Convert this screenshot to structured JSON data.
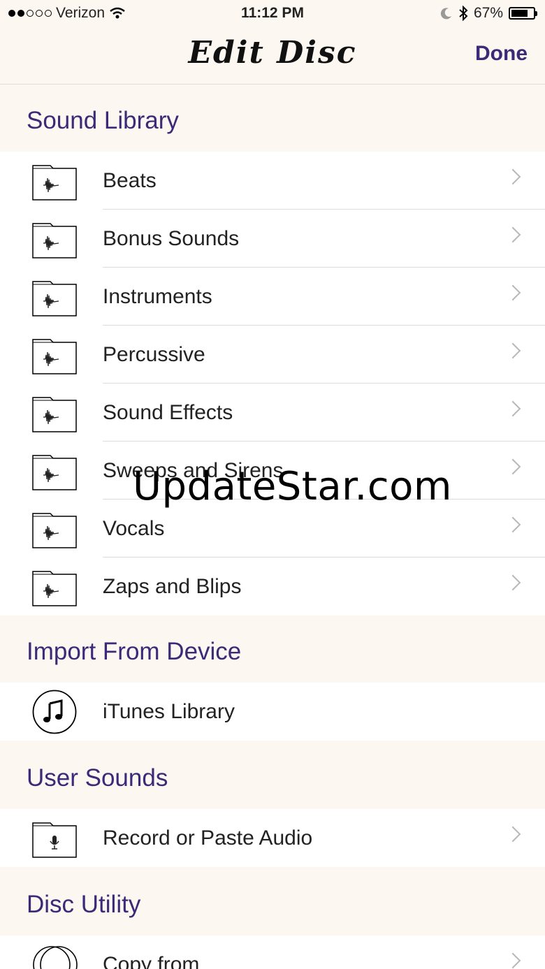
{
  "status_bar": {
    "carrier": "Verizon",
    "time": "11:12 PM",
    "battery": "67%"
  },
  "nav": {
    "title": "Edit Disc",
    "done": "Done"
  },
  "sections": {
    "sound_library": {
      "header": "Sound Library",
      "items": [
        "Beats",
        "Bonus Sounds",
        "Instruments",
        "Percussive",
        "Sound Effects",
        "Sweeps and Sirens",
        "Vocals",
        "Zaps and Blips"
      ]
    },
    "import_from_device": {
      "header": "Import From Device",
      "items": [
        "iTunes Library"
      ]
    },
    "user_sounds": {
      "header": "User Sounds",
      "items": [
        "Record or Paste Audio"
      ]
    },
    "disc_utility": {
      "header": "Disc Utility",
      "items": [
        "Copy from"
      ]
    }
  },
  "watermark": "UpdateStar.com",
  "colors": {
    "accent": "#3a2a78",
    "background": "#fcf7f1"
  }
}
